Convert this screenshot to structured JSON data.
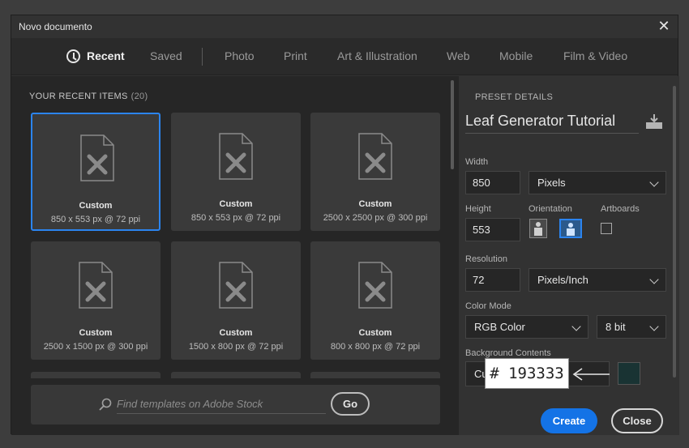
{
  "window": {
    "title": "Novo documento",
    "close_glyph": "✕"
  },
  "tabs": [
    {
      "label": "Recent",
      "active": true
    },
    {
      "label": "Saved"
    },
    {
      "label": "Photo"
    },
    {
      "label": "Print"
    },
    {
      "label": "Art & Illustration"
    },
    {
      "label": "Web"
    },
    {
      "label": "Mobile"
    },
    {
      "label": "Film & Video"
    }
  ],
  "recent": {
    "heading": "YOUR RECENT ITEMS",
    "count": "(20)",
    "items": [
      {
        "name": "Custom",
        "size": "850 x 553 px @ 72 ppi",
        "selected": true
      },
      {
        "name": "Custom",
        "size": "850 x 553 px @ 72 ppi"
      },
      {
        "name": "Custom",
        "size": "2500 x 2500 px @ 300 ppi"
      },
      {
        "name": "Custom",
        "size": "2500 x 1500 px @ 300 ppi"
      },
      {
        "name": "Custom",
        "size": "1500 x 800 px @ 72 ppi"
      },
      {
        "name": "Custom",
        "size": "800 x 800 px @ 72 ppi"
      }
    ]
  },
  "stock": {
    "placeholder": "Find templates on Adobe Stock",
    "go_label": "Go"
  },
  "preset": {
    "heading": "PRESET DETAILS",
    "name": "Leaf Generator Tutorial",
    "width_label": "Width",
    "width_value": "850",
    "width_unit": "Pixels",
    "height_label": "Height",
    "height_value": "553",
    "orientation_label": "Orientation",
    "artboards_label": "Artboards",
    "resolution_label": "Resolution",
    "resolution_value": "72",
    "resolution_unit": "Pixels/Inch",
    "color_mode_label": "Color Mode",
    "color_mode": "RGB Color",
    "bit_depth": "8 bit",
    "bg_label": "Background Contents",
    "bg_value": "Cu",
    "bg_color": "#193333",
    "hex_callout": "# 193333",
    "create_label": "Create",
    "close_label": "Close"
  },
  "colors": {
    "accent": "#1473e6",
    "selection": "#2b84ef",
    "swatch": "#193333"
  }
}
